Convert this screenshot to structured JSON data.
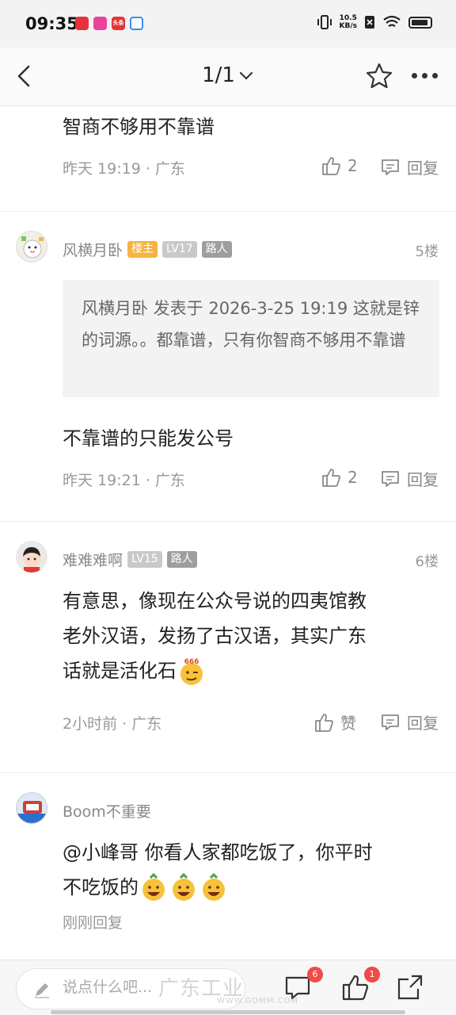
{
  "status_bar": {
    "time": "09:35",
    "net_speed_value": "10.5",
    "net_speed_unit": "KB/s",
    "app_icons": [
      {
        "name": "app-icon-red",
        "color": "#e8323a"
      },
      {
        "name": "app-icon-pink",
        "color": "#e9439b"
      },
      {
        "name": "app-icon-toutiao",
        "color": "#e8323a",
        "text": "头条"
      },
      {
        "name": "app-icon-blue",
        "color": "#3c8cf0"
      }
    ]
  },
  "nav": {
    "title": "1/1"
  },
  "comments": [
    {
      "body": "智商不够用不靠谱",
      "meta": "昨天 19:19 · 广东",
      "likes": "2",
      "reply_label": "回复"
    },
    {
      "username": "风横月卧",
      "badges": [
        "楼主",
        "LV17",
        "路人"
      ],
      "floor": "5楼",
      "quote": "风横月卧 发表于 2026-3-25 19:19 这就是锌的词源。。都靠谱，只有你智商不够用不靠谱",
      "body": "不靠谱的只能发公号",
      "meta": "昨天 19:21 · 广东",
      "likes": "2",
      "reply_label": "回复"
    },
    {
      "username": "难难难啊",
      "badges": [
        "LV15",
        "路人"
      ],
      "floor": "6楼",
      "body_line1": "有意思，像现在公众号说的四夷馆教",
      "body_line2": "老外汉语，发扬了古汉语，其实广东",
      "body_line3": "话就是活化石",
      "emoji_text": "666",
      "meta": "2小时前 · 广东",
      "likes": "赞",
      "reply_label": "回复"
    },
    {
      "username": "Boom不重要",
      "body_line1": "@小峰哥 你看人家都吃饭了，你平时",
      "body_line2": "不吃饭的",
      "meta": "刚刚回复"
    }
  ],
  "bottom_bar": {
    "input_placeholder": "说点什么吧...",
    "comment_count": "6",
    "like_count": "1"
  },
  "watermark": {
    "text": "广东工业",
    "url": "WWW.GDMM.COM"
  },
  "colors": {
    "owner_badge": "#f5b342",
    "level_badge": "#c9c9c9",
    "role_badge": "#9e9e9e",
    "count_badge": "#f04a4a"
  }
}
